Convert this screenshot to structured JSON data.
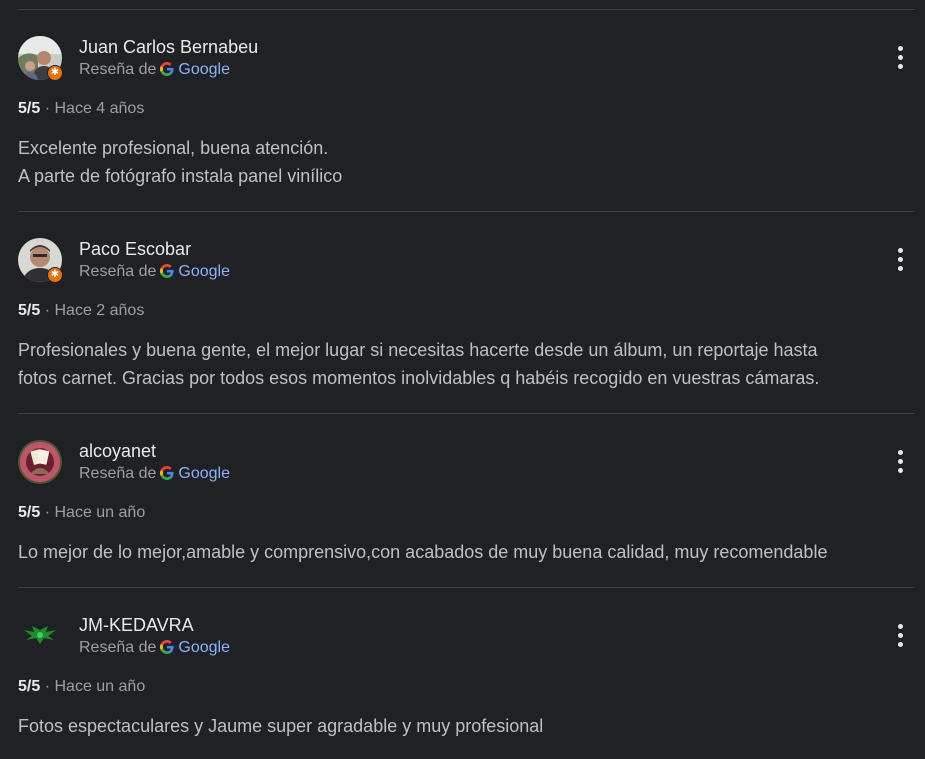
{
  "reviews": [
    {
      "name": "Juan Carlos Bernabeu",
      "source_prefix": "Reseña de",
      "source_name": "Google",
      "rating": "5/5",
      "separator": "·",
      "time": "Hace 4 años",
      "text_lines": [
        "Excelente profesional, buena atención.",
        "A parte de fotógrafo instala panel vinílico"
      ],
      "local_guide": true
    },
    {
      "name": "Paco Escobar",
      "source_prefix": "Reseña de",
      "source_name": "Google",
      "rating": "5/5",
      "separator": "·",
      "time": "Hace 2 años",
      "text_lines": [
        "Profesionales y buena gente, el mejor lugar si necesitas hacerte desde un álbum, un reportaje hasta",
        "fotos carnet. Gracias por todos esos momentos inolvidables q habéis recogido en vuestras cámaras."
      ],
      "local_guide": true
    },
    {
      "name": "alcoyanet",
      "source_prefix": "Reseña de",
      "source_name": "Google",
      "rating": "5/5",
      "separator": "·",
      "time": "Hace un año",
      "text_lines": [
        "Lo mejor de lo mejor,amable y comprensivo,con acabados de muy buena calidad, muy recomendable"
      ],
      "local_guide": false
    },
    {
      "name": "JM-KEDAVRA",
      "source_prefix": "Reseña de",
      "source_name": "Google",
      "rating": "5/5",
      "separator": "·",
      "time": "Hace un año",
      "text_lines": [
        "Fotos espectaculares y Jaume super agradable y muy profesional"
      ],
      "local_guide": false
    }
  ]
}
